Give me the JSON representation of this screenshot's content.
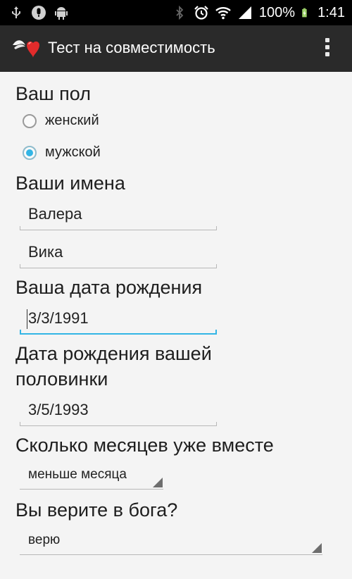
{
  "status_bar": {
    "icons_left": [
      "usb-icon",
      "microphone-icon",
      "android-icon"
    ],
    "icons_right": [
      "bluetooth-icon",
      "alarm-icon",
      "wifi-icon",
      "signal-icon",
      "battery-icon"
    ],
    "battery": "100%",
    "time": "1:41"
  },
  "action_bar": {
    "title": "Тест на совместимость",
    "app_icon": "winged-heart-icon",
    "overflow_icon": "overflow-menu-icon"
  },
  "form": {
    "gender": {
      "label": "Ваш пол",
      "options": [
        {
          "label": "женский",
          "checked": false
        },
        {
          "label": "мужской",
          "checked": true
        }
      ]
    },
    "names": {
      "label": "Ваши имена",
      "your_name": "Валера",
      "partner_name": "Вика"
    },
    "your_birthdate": {
      "label": "Ваша дата рождения",
      "value": "3/3/1991"
    },
    "partner_birthdate": {
      "label_line1": "Дата рождения вашей",
      "label_line2": "половинки",
      "value": "3/5/1993"
    },
    "months_together": {
      "label": "Сколько месяцев уже вместе",
      "value": "меньше месяца"
    },
    "belief": {
      "label": "Вы верите в бога?",
      "value": "верю"
    }
  },
  "colors": {
    "accent": "#33b5e5",
    "action_bar_bg": "#2a2a2a",
    "status_bar_bg": "#000000",
    "content_bg": "#f4f4f4"
  }
}
